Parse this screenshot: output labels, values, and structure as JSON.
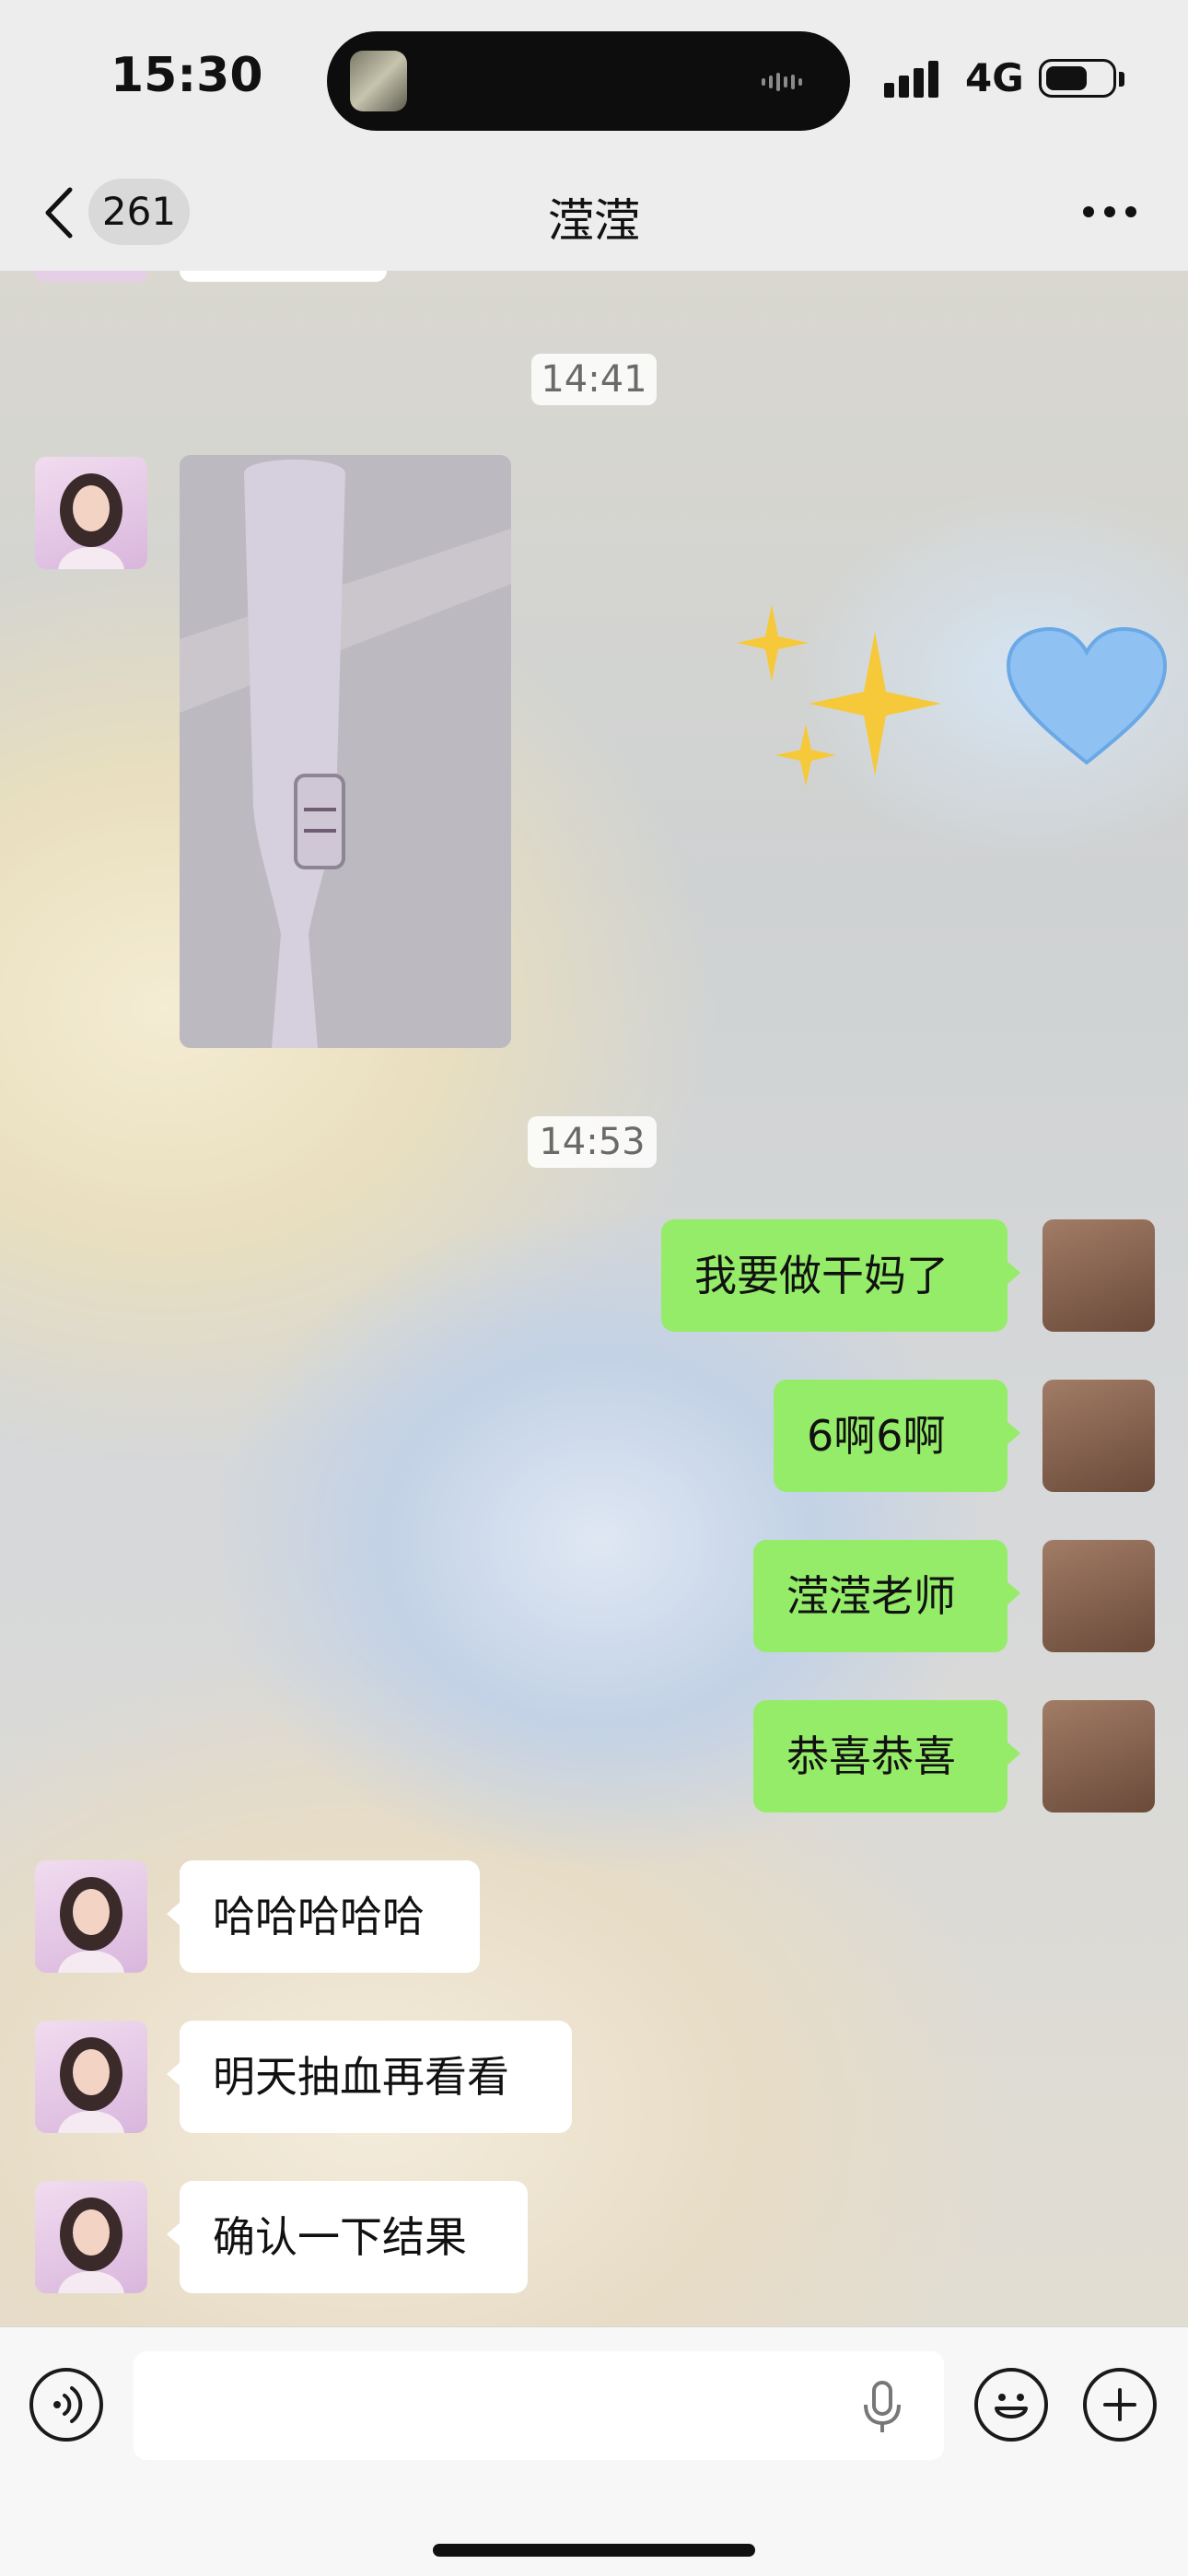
{
  "status_bar": {
    "time": "15:30",
    "network": "4G"
  },
  "nav": {
    "unread_count": "261",
    "title": "滢滢"
  },
  "messages": [
    {
      "time": "14:41"
    },
    {
      "time": "14:53"
    },
    {
      "text": "我要做干妈了"
    },
    {
      "text": "6啊6啊"
    },
    {
      "text": "滢滢老师"
    },
    {
      "text": "恭喜恭喜"
    },
    {
      "text": "哈哈哈哈哈"
    },
    {
      "text": "明天抽血再看看"
    },
    {
      "text": "确认一下结果"
    }
  ],
  "input": {
    "placeholder": ""
  },
  "icons": {
    "back": "chevron-left-icon",
    "more": "more-dots-icon",
    "voice": "voice-icon",
    "mic": "microphone-icon",
    "emoji": "emoji-icon",
    "add": "plus-icon"
  },
  "colors": {
    "outgoing_bubble": "#95ec69",
    "incoming_bubble": "#ffffff",
    "bar_bg": "#ededed"
  }
}
